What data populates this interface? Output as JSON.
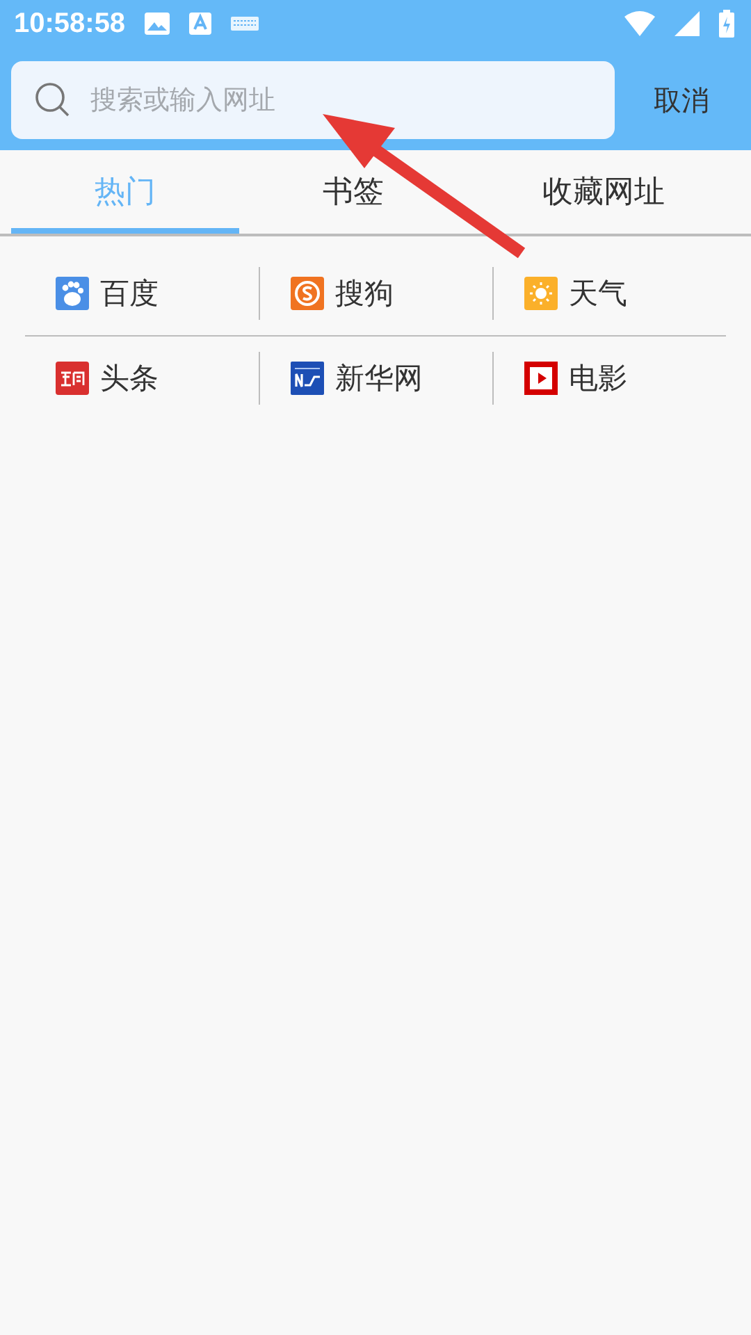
{
  "status_bar": {
    "time": "10:58:58"
  },
  "search": {
    "placeholder": "搜索或输入网址",
    "cancel": "取消"
  },
  "tabs": [
    {
      "label": "热门",
      "selected": true
    },
    {
      "label": "书签",
      "selected": false
    },
    {
      "label": "收藏网址",
      "selected": false
    }
  ],
  "sites": [
    {
      "label": "百度",
      "kind": "paw"
    },
    {
      "label": "搜狗",
      "kind": "sogou"
    },
    {
      "label": "天气",
      "kind": "sun"
    },
    {
      "label": "头条",
      "kind": "news"
    },
    {
      "label": "新华网",
      "kind": "xinhua"
    },
    {
      "label": "电影",
      "kind": "video"
    }
  ]
}
